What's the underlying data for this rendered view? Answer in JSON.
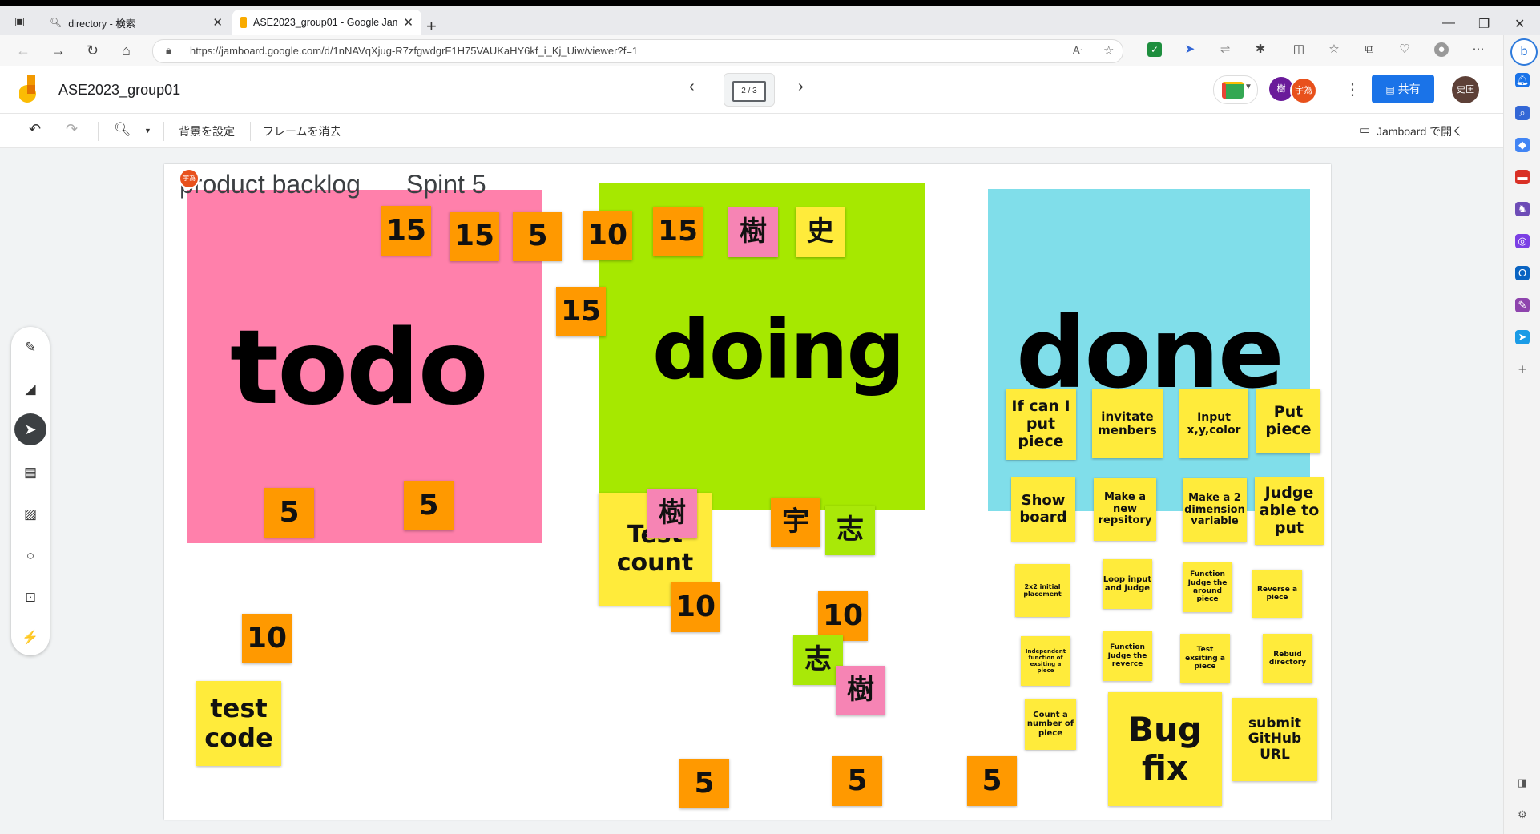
{
  "browser": {
    "tabs": [
      {
        "title": "directory - 検索"
      },
      {
        "title": "ASE2023_group01 - Google Jamboard"
      }
    ],
    "url": "https://jamboard.google.com/d/1nNAVqXjug-R7zfgwdgrF1H75VAUKaHY6kf_i_Kj_Uiw/viewer?f=1"
  },
  "app": {
    "title": "ASE2023_group01",
    "frame_indicator": "2 / 3",
    "share_label": "共有",
    "open_in_jamboard": "Jamboard で開く",
    "user_avatar": "史匡",
    "collaborators": [
      "樹",
      "宇為"
    ]
  },
  "toolbar": {
    "set_background": "背景を設定",
    "clear_frame": "フレームを消去"
  },
  "board": {
    "heading_backlog": "product backlog",
    "heading_sprint": "Spint 5",
    "cursor_label": "宇為",
    "columns": {
      "todo": "todo",
      "doing": "doing",
      "done": "done"
    },
    "colors": {
      "todo": "#ff80ab",
      "doing": "#a6e800",
      "done": "#80deea",
      "orange_note": "#ff9900",
      "yellow_note": "#ffeb3b",
      "pink_note": "#f684b4",
      "green_note": "#a9e808"
    },
    "notes": {
      "n15a": "15",
      "n15b": "15",
      "n5a": "5",
      "n10a": "10",
      "n15c": "15",
      "k_ki1": "樹",
      "k_shi1": "史",
      "n15d": "15",
      "n5b": "5",
      "n5c": "5",
      "test_count": "Test count",
      "k_ki2": "樹",
      "k_u": "宇",
      "k_shi2": "志",
      "n10b": "10",
      "n10c": "10",
      "k_shi3": "志",
      "k_ki3": "樹",
      "n10d": "10",
      "test_code": "test code",
      "n5d": "5",
      "n5e": "5",
      "n5f": "5",
      "done_if_can": "If can I put piece",
      "done_invite": "invitate menbers",
      "done_input": "Input x,y,color",
      "done_put": "Put piece",
      "done_show": "Show board",
      "done_repo": "Make a new repsitory",
      "done_2dim": "Make a 2 dimension variable",
      "done_judge_put": "Judge able to put",
      "done_2x2": "2x2 initial placement",
      "done_loop": "Loop input and judge",
      "done_func_around": "Function Judge the around piece",
      "done_reverse": "Reverse a piece",
      "done_indep": "Independent function of exsiting a piece",
      "done_func_rev": "Function Judge the reverce",
      "done_test_exist": "Test exsiting a piece",
      "done_rebuild": "Rebuid directory",
      "done_count": "Count a number of piece",
      "done_bugfix": "Bug fix",
      "done_submit": "submit GitHub URL"
    }
  }
}
